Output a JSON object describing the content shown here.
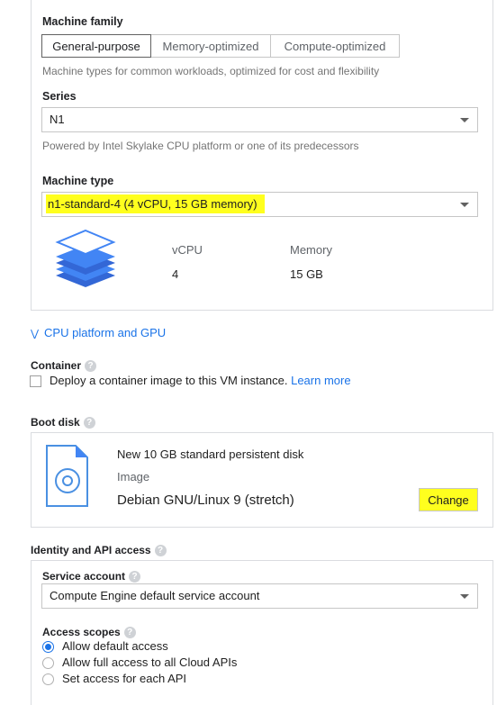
{
  "machine_configuration": {
    "family_label": "Machine family",
    "family_tabs": [
      "General-purpose",
      "Memory-optimized",
      "Compute-optimized"
    ],
    "family_selected": "General-purpose",
    "family_hint": "Machine types for common workloads, optimized for cost and flexibility",
    "series_label": "Series",
    "series_value": "N1",
    "series_hint": "Powered by Intel Skylake CPU platform or one of its predecessors",
    "machine_type_label": "Machine type",
    "machine_type_value": "n1-standard-4 (4 vCPU, 15 GB memory)",
    "vcpu_label": "vCPU",
    "vcpu_value": "4",
    "memory_label": "Memory",
    "memory_value": "15 GB"
  },
  "cpu_platform_link": "CPU platform and GPU",
  "container": {
    "label": "Container",
    "checkbox_text": "Deploy a container image to this VM instance.",
    "learn_more": "Learn more",
    "checked": false
  },
  "boot_disk": {
    "label": "Boot disk",
    "title": "New 10 GB standard persistent disk",
    "image_label": "Image",
    "image_value": "Debian GNU/Linux 9 (stretch)",
    "change_button": "Change"
  },
  "identity": {
    "label": "Identity and API access",
    "service_account_label": "Service account",
    "service_account_value": "Compute Engine default service account",
    "access_scopes_label": "Access scopes",
    "scopes": [
      {
        "label": "Allow default access",
        "selected": true
      },
      {
        "label": "Allow full access to all Cloud APIs",
        "selected": false
      },
      {
        "label": "Set access for each API",
        "selected": false
      }
    ]
  },
  "colors": {
    "highlight": "#ffff1e",
    "link": "#1a73e8",
    "icon_blue": "#4285f4"
  }
}
